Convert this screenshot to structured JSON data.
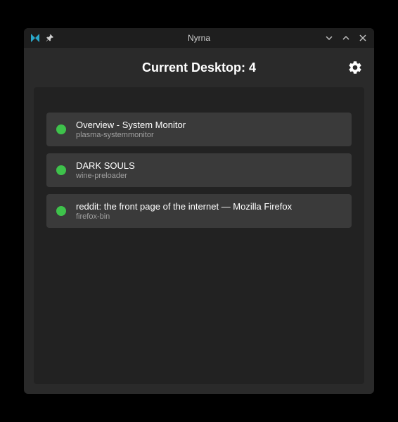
{
  "titlebar": {
    "title": "Nyrna"
  },
  "header": {
    "title": "Current Desktop: 4"
  },
  "colors": {
    "status_running": "#3ec24b",
    "app_icon": "#2aa7c9"
  },
  "items": [
    {
      "title": "Overview - System Monitor",
      "process": "plasma-systemmonitor"
    },
    {
      "title": "DARK SOULS",
      "process": "wine-preloader"
    },
    {
      "title": "reddit: the front page of the internet — Mozilla Firefox",
      "process": "firefox-bin"
    }
  ]
}
